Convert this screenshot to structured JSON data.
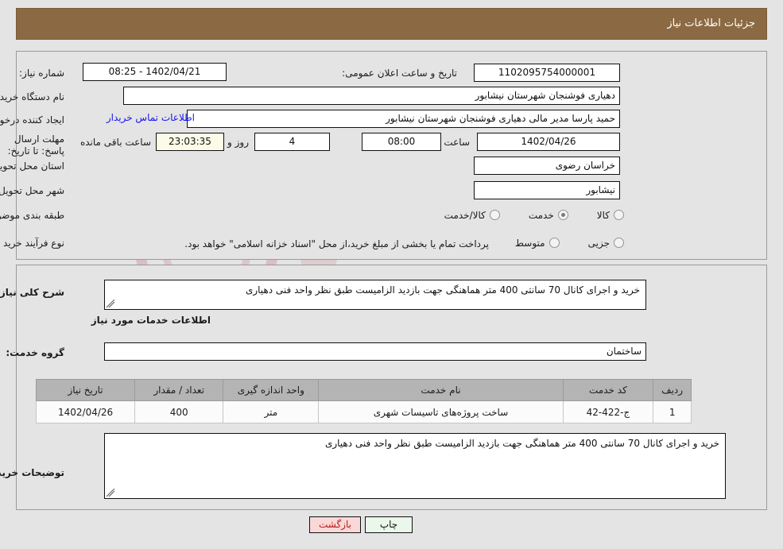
{
  "header": {
    "title": "جزئیات اطلاعات نیاز"
  },
  "form": {
    "need_number_label": "شماره نیاز:",
    "need_number_value": "1102095754000001",
    "announce_label": "تاریخ و ساعت اعلان عمومی:",
    "announce_value": "1402/04/21 - 08:25",
    "buyer_org_label": "نام دستگاه خریدار:",
    "buyer_org_value": "دهیاری فوشنجان  شهرستان نیشابور",
    "creator_label": "ایجاد کننده درخواست:",
    "creator_value": "حمید پارسا مدیر مالی دهیاری فوشنجان  شهرستان نیشابور",
    "contact_link": "اطلاعات تماس خریدار",
    "deadline_label": "مهلت ارسال پاسخ: تا تاریخ:",
    "deadline_date": "1402/04/26",
    "deadline_hour_label": "ساعت",
    "deadline_hour": "08:00",
    "remaining_days": "4",
    "remaining_days_unit": "روز و",
    "remaining_time": "23:03:35",
    "remaining_time_unit": "ساعت باقی مانده",
    "province_label": "استان محل تحویل:",
    "province_value": "خراسان رضوی",
    "city_label": "شهر محل تحویل:",
    "city_value": "نیشابور",
    "category_label": "طبقه بندی موضوعی:",
    "category_options": [
      {
        "label": "کالا",
        "selected": false
      },
      {
        "label": "خدمت",
        "selected": true
      },
      {
        "label": "کالا/خدمت",
        "selected": false
      }
    ],
    "process_label": "نوع فرآیند خرید :",
    "process_options": [
      {
        "label": "جزیی",
        "selected": false
      },
      {
        "label": "متوسط",
        "selected": false
      }
    ],
    "process_note": "پرداخت تمام یا بخشی از مبلغ خرید،از محل \"اسناد خزانه اسلامی\" خواهد بود."
  },
  "need": {
    "summary_label": "شرح کلی نیاز:",
    "summary_value": "خرید و اجرای کانال 70 سانتی  400 متر هماهنگی جهت بازدید الزامیست طبق نظر واحد فنی دهیاری",
    "services_heading": "اطلاعات خدمات مورد نیاز",
    "service_group_label": "گروه خدمت:",
    "service_group_value": "ساختمان"
  },
  "table": {
    "columns": [
      "ردیف",
      "کد خدمت",
      "نام خدمت",
      "واحد اندازه گیری",
      "تعداد / مقدار",
      "تاریخ نیاز"
    ],
    "rows": [
      {
        "row_no": "1",
        "service_code": "ج-422-42",
        "service_name": "ساخت پروژه‌های تاسیسات شهری",
        "unit": "متر",
        "quantity": "400",
        "need_date": "1402/04/26"
      }
    ]
  },
  "buyer_notes": {
    "label": "توضیحات خریدار:",
    "value": "خرید و اجرای کانال 70 سانتی  400 متر هماهنگی جهت بازدید الزامیست طبق نظر واحد فنی دهیاری"
  },
  "footer": {
    "print_label": "چاپ",
    "back_label": "بازگشت"
  },
  "watermark": {
    "text": "AriaTender.net"
  },
  "colors": {
    "header_bg": "#8b6a43",
    "page_bg": "#e4e4e4",
    "link": "#1714ef",
    "back_btn": "#fbd8d8",
    "print_btn": "#eaf7ea",
    "table_header": "#b4b4b4"
  }
}
